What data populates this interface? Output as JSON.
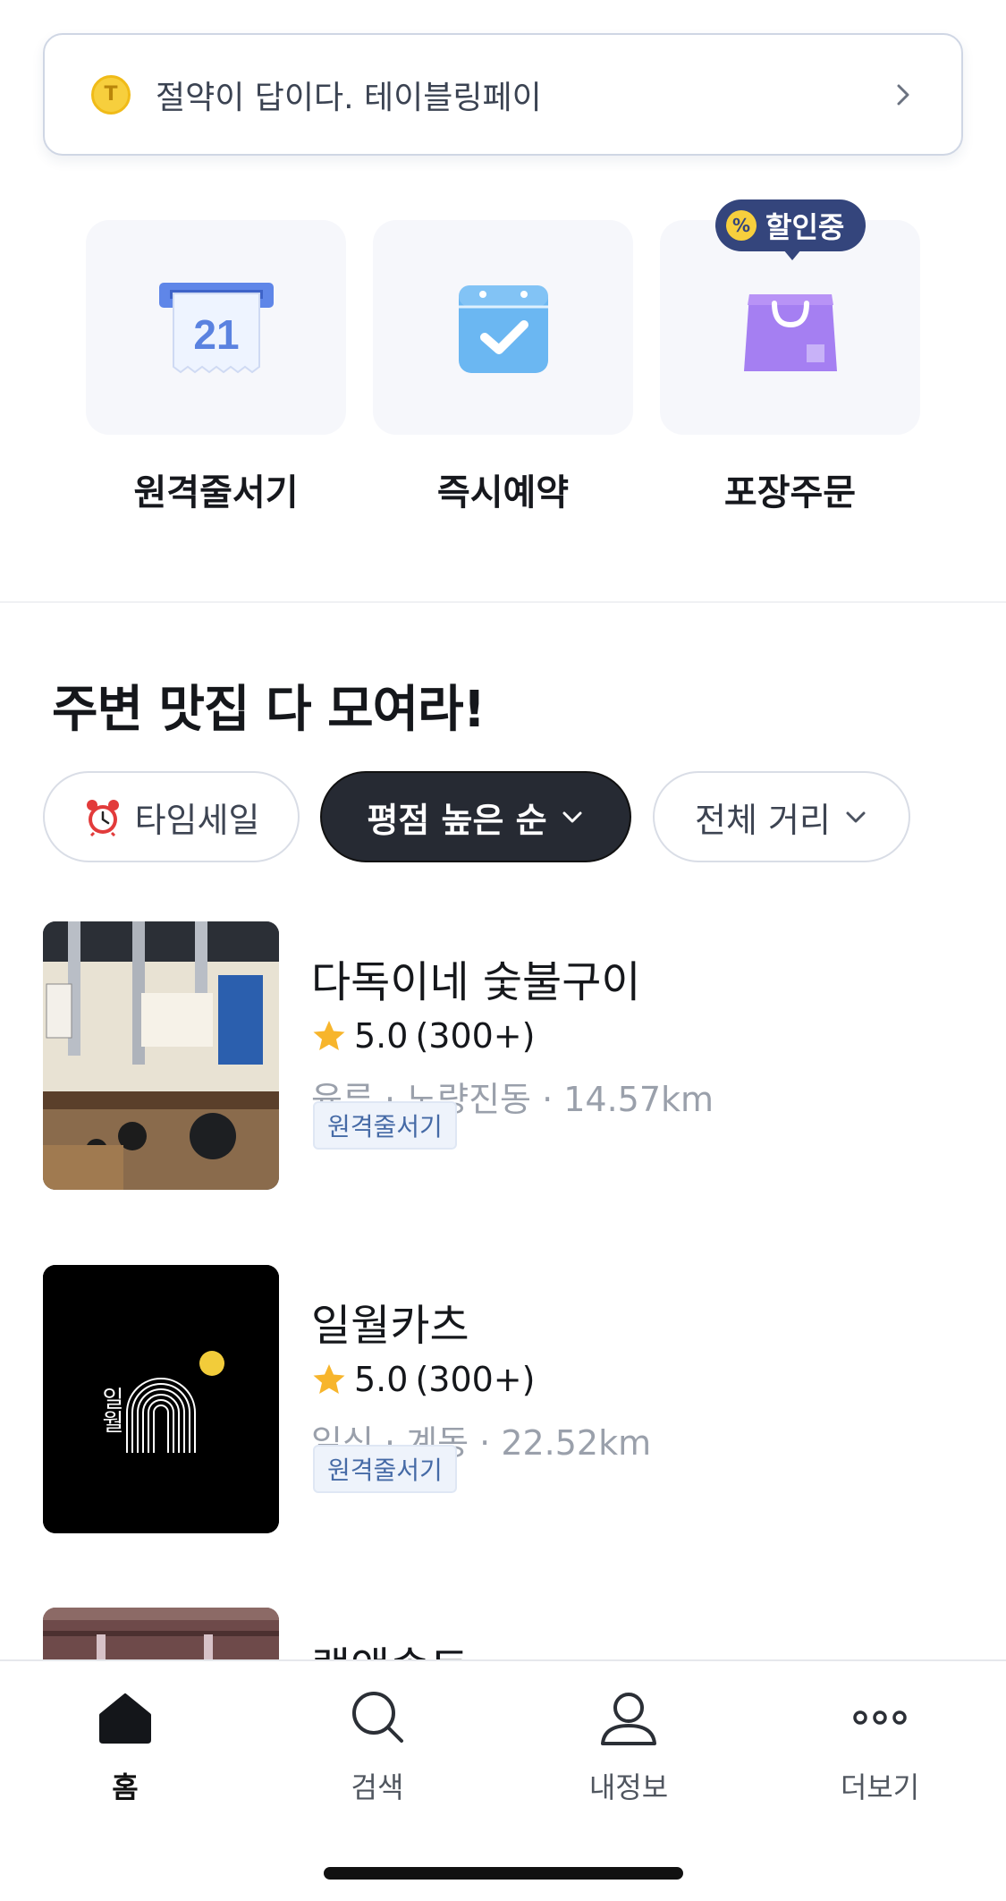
{
  "promo": {
    "text": "절약이 답이다. 테이블링페이",
    "coin_letter": "T"
  },
  "services": [
    {
      "label": "원격줄서기",
      "icon": "ticket-calendar-icon",
      "icon_text": "21"
    },
    {
      "label": "즉시예약",
      "icon": "calendar-check-icon"
    },
    {
      "label": "포장주문",
      "icon": "shopping-bag-icon",
      "badge": "할인중"
    }
  ],
  "section": {
    "title": "주변 맛집 다 모여라!"
  },
  "filters": [
    {
      "label": "타임세일",
      "icon": "alarm-clock-icon",
      "active": false
    },
    {
      "label": "평점 높은 순",
      "active": true
    },
    {
      "label": "전체 거리",
      "active": false
    }
  ],
  "restaurants": [
    {
      "name": "다독이네 숯불구이",
      "rating": "5.0",
      "reviews": "(300+)",
      "meta": "육류 · 노량진동 · 14.57km",
      "tag": "원격줄서기"
    },
    {
      "name": "일월카츠",
      "rating": "5.0",
      "reviews": "(300+)",
      "meta": "일식 · 계동 · 22.52km",
      "tag": "원격줄서기",
      "logo_text": "일월"
    },
    {
      "name": "램앤솔트"
    }
  ],
  "nav": [
    {
      "label": "홈",
      "icon": "home-icon",
      "active": true
    },
    {
      "label": "검색",
      "icon": "search-icon",
      "active": false
    },
    {
      "label": "내정보",
      "icon": "user-icon",
      "active": false
    },
    {
      "label": "더보기",
      "icon": "more-icon",
      "active": false
    }
  ],
  "colors": {
    "accent": "#262a33",
    "badge": "#34457c",
    "star": "#f7b52c",
    "tag_text": "#456aa6"
  }
}
